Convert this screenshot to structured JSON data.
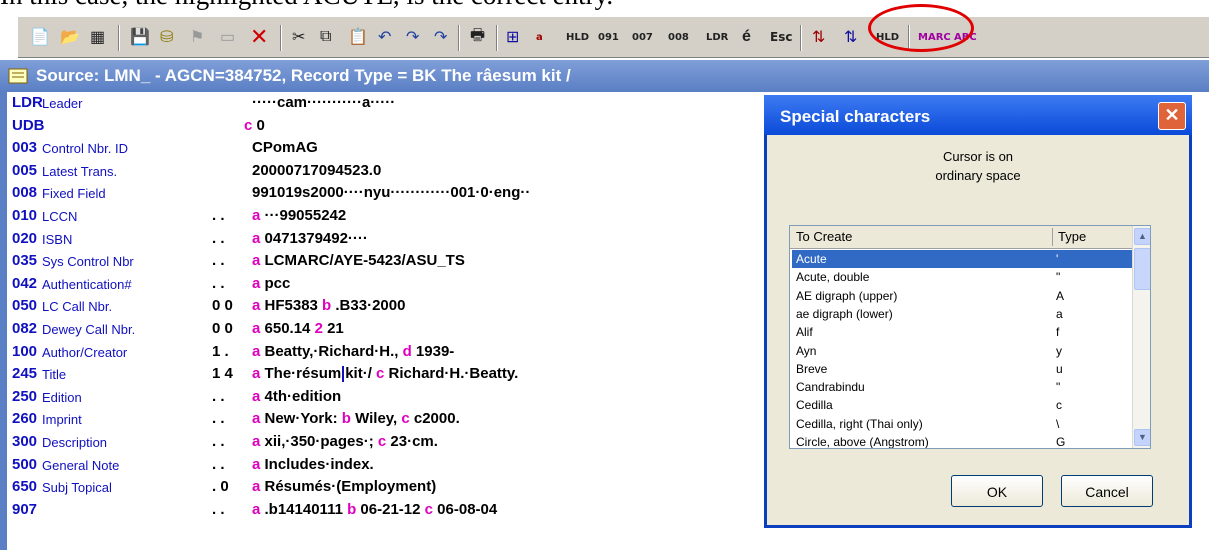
{
  "caption": "In this case, the highlighted ACUTE, is the correct entry.",
  "toolbar": {
    "icons": [
      "new-record-icon",
      "open-icon",
      "grid-icon",
      "save-icon",
      "database-icon",
      "flag-icon",
      "card-icon",
      "delete-icon",
      "cut-icon",
      "copy-icon",
      "paste-icon",
      "undo-icon",
      "redo-icon",
      "redo-alt-icon",
      "print-icon",
      "insert-field-icon",
      "insert-subfield-icon",
      "hld-icon",
      "091-icon",
      "007-icon",
      "008-icon",
      "ldr-icon",
      "acute-char-icon",
      "esc-char-icon",
      "sort-icon",
      "sort-alt-icon",
      "hld-alt-icon",
      "marc-validate-icon",
      "abc-validate-icon"
    ],
    "labels": {
      "hld": "HLD",
      "f091": "091",
      "f007": "007",
      "f008": "008",
      "ldr": "LDR",
      "acute": "é",
      "esc": "Esc",
      "hld2": "HLD",
      "marc": "MARC",
      "abc": "ABC"
    }
  },
  "window_title": "Source: LMN_ - AGCN=384752,  Record Type = BK The râesum kit /",
  "record": [
    {
      "tag": "LDR",
      "label": "Leader",
      "ind": "",
      "value": "·····cam···········a·····"
    },
    {
      "tag": "UDB",
      "label": "",
      "ind": "",
      "value_parts": [
        {
          "sub": "c"
        },
        {
          "text": " 0"
        }
      ]
    },
    {
      "tag": "003",
      "label": "Control Nbr. ID",
      "ind": "",
      "value": "CPomAG"
    },
    {
      "tag": "005",
      "label": "Latest Trans.",
      "ind": "",
      "value": "20000717094523.0"
    },
    {
      "tag": "008",
      "label": "Fixed Field",
      "ind": "",
      "value": "991019s2000····nyu············001·0·eng··"
    },
    {
      "tag": "010",
      "label": "LCCN",
      "ind": ". .",
      "value_parts": [
        {
          "sub": "a"
        },
        {
          "text": " ···99055242"
        }
      ]
    },
    {
      "tag": "020",
      "label": "ISBN",
      "ind": ". .",
      "value_parts": [
        {
          "sub": "a"
        },
        {
          "text": " 0471379492····"
        }
      ]
    },
    {
      "tag": "035",
      "label": "Sys Control Nbr",
      "ind": ". .",
      "value_parts": [
        {
          "sub": "a"
        },
        {
          "text": " LCMARC/AYE-5423/ASU_TS"
        }
      ]
    },
    {
      "tag": "042",
      "label": "Authentication#",
      "ind": ". .",
      "value_parts": [
        {
          "sub": "a"
        },
        {
          "text": " pcc"
        }
      ]
    },
    {
      "tag": "050",
      "label": "LC Call Nbr.",
      "ind": "0 0",
      "value_parts": [
        {
          "sub": "a"
        },
        {
          "text": " HF5383  "
        },
        {
          "sub": "b"
        },
        {
          "text": " .B33·2000"
        }
      ]
    },
    {
      "tag": "082",
      "label": "Dewey Call Nbr.",
      "ind": "0 0",
      "value_parts": [
        {
          "sub": "a"
        },
        {
          "text": " 650.14  "
        },
        {
          "sub": "2"
        },
        {
          "text": " 21"
        }
      ]
    },
    {
      "tag": "100",
      "label": "Author/Creator",
      "ind": "1 .",
      "value_parts": [
        {
          "sub": "a"
        },
        {
          "text": " Beatty,·Richard·H.,  "
        },
        {
          "sub": "d"
        },
        {
          "text": " 1939-"
        }
      ]
    },
    {
      "tag": "245",
      "label": "Title",
      "ind": "1 4",
      "value_parts": [
        {
          "sub": "a"
        },
        {
          "text": " The·résum"
        },
        {
          "cursor": true
        },
        {
          "text": "kit·/  "
        },
        {
          "sub": "c"
        },
        {
          "text": " Richard·H.·Beatty."
        }
      ]
    },
    {
      "tag": "250",
      "label": "Edition",
      "ind": ". .",
      "value_parts": [
        {
          "sub": "a"
        },
        {
          "text": " 4th·edition"
        }
      ]
    },
    {
      "tag": "260",
      "label": "Imprint",
      "ind": ". .",
      "value_parts": [
        {
          "sub": "a"
        },
        {
          "text": " New·York:  "
        },
        {
          "sub": "b"
        },
        {
          "text": " Wiley,  "
        },
        {
          "sub": "c"
        },
        {
          "text": " c2000."
        }
      ]
    },
    {
      "tag": "300",
      "label": "Description",
      "ind": ". .",
      "value_parts": [
        {
          "sub": "a"
        },
        {
          "text": " xii,·350·pages·;  "
        },
        {
          "sub": "c"
        },
        {
          "text": " 23·cm."
        }
      ]
    },
    {
      "tag": "500",
      "label": "General Note",
      "ind": ". .",
      "value_parts": [
        {
          "sub": "a"
        },
        {
          "text": " Includes·index."
        }
      ]
    },
    {
      "tag": "650",
      "label": "Subj Topical",
      "ind": ". 0",
      "value_parts": [
        {
          "sub": "a"
        },
        {
          "text": " Résumés·(Employment)"
        }
      ]
    },
    {
      "tag": "907",
      "label": "",
      "ind": ". .",
      "value_parts": [
        {
          "sub": "a"
        },
        {
          "text": " .b14140111  "
        },
        {
          "sub": "b"
        },
        {
          "text": " 06-21-12  "
        },
        {
          "sub": "c"
        },
        {
          "text": " 06-08-04"
        }
      ]
    }
  ],
  "record_ind_udb": "c",
  "dialog": {
    "title": "Special characters",
    "close": "✕",
    "status_line1": "Cursor is on",
    "status_line2": "ordinary space",
    "col_create": "To Create",
    "col_type": "Type",
    "items": [
      {
        "name": "Acute",
        "type": "'",
        "selected": true
      },
      {
        "name": "Acute, double",
        "type": "\""
      },
      {
        "name": "AE digraph (upper)",
        "type": "A"
      },
      {
        "name": "ae digraph (lower)",
        "type": "a"
      },
      {
        "name": "Alif",
        "type": "f"
      },
      {
        "name": "Ayn",
        "type": "y"
      },
      {
        "name": "Breve",
        "type": "u"
      },
      {
        "name": "Candrabindu",
        "type": "\""
      },
      {
        "name": "Cedilla",
        "type": "c"
      },
      {
        "name": "Cedilla, right (Thai only)",
        "type": "\\"
      },
      {
        "name": "Circle, above (Angstrom)",
        "type": "G"
      }
    ],
    "ok": "OK",
    "cancel": "Cancel"
  }
}
